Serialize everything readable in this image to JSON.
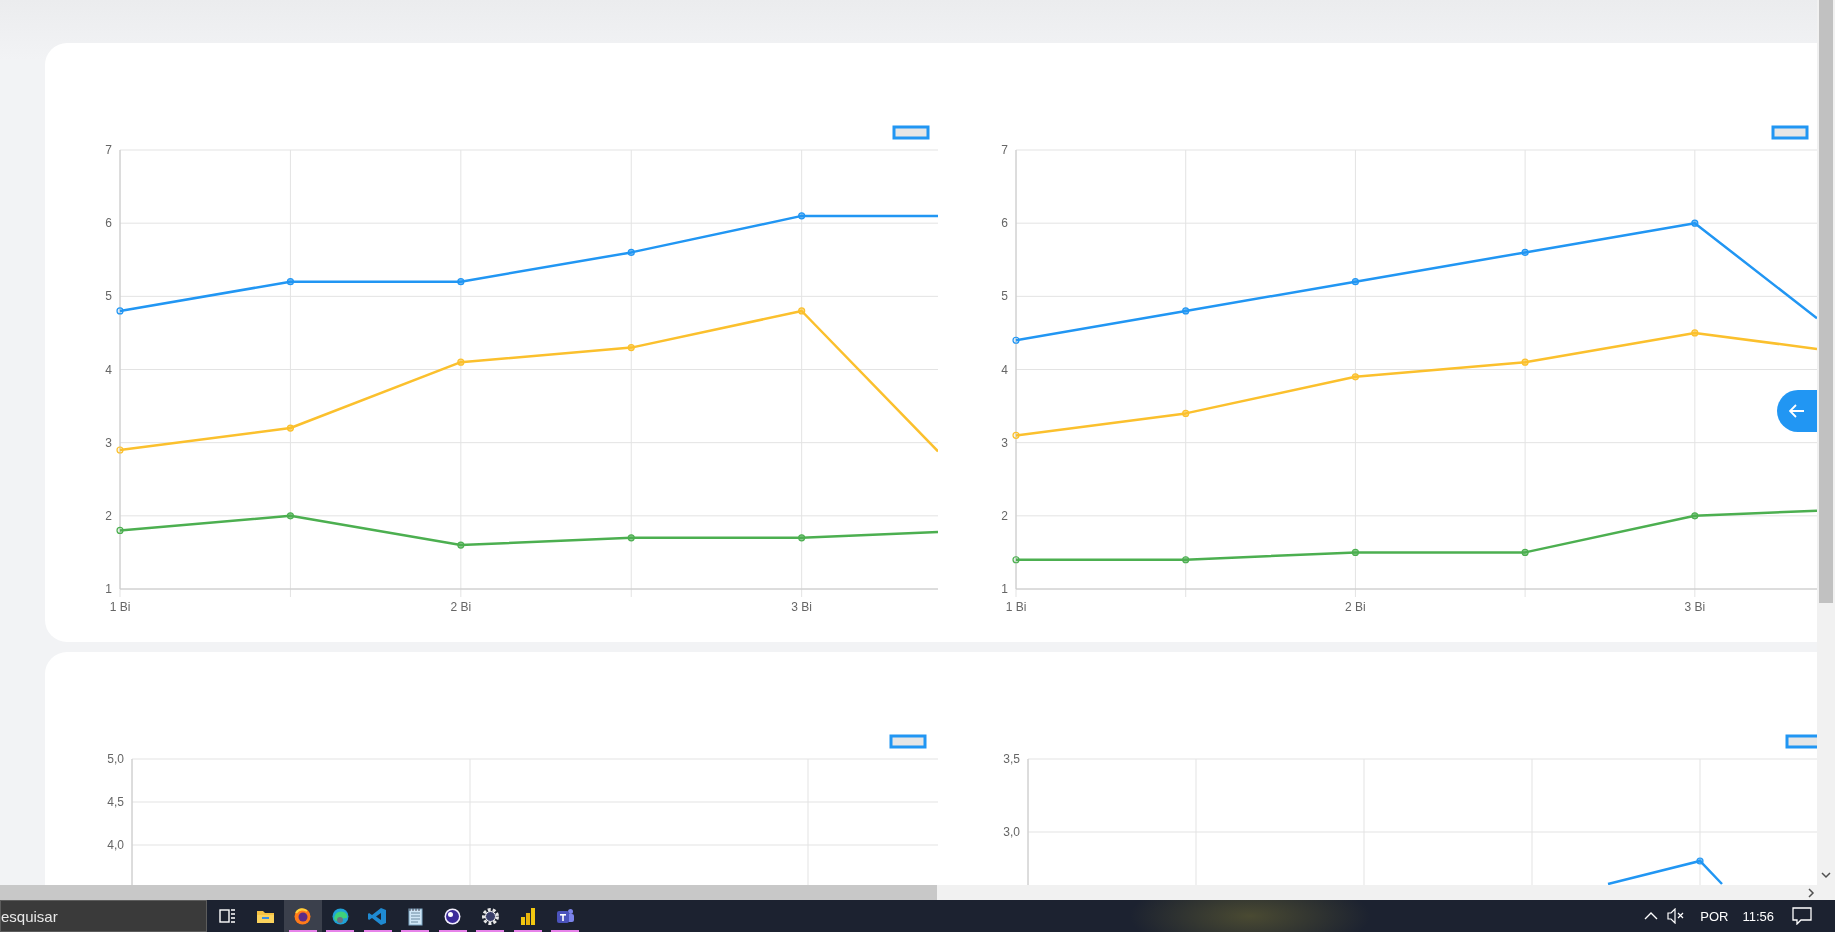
{
  "dashboard": {
    "cards": [
      {
        "charts": [
          {
            "chart_data": {
              "type": "line",
              "grid": true,
              "x": [
                1,
                1.5,
                2,
                2.5,
                3,
                3.4
              ],
              "xlim": [
                1,
                3.4
              ],
              "xticks": [
                {
                  "value": 1,
                  "label": "1 Bi"
                },
                {
                  "value": 2,
                  "label": "2 Bi"
                },
                {
                  "value": 3,
                  "label": "3 Bi"
                }
              ],
              "ylim": [
                1,
                7
              ],
              "yticks": [
                1,
                2,
                3,
                4,
                5,
                6,
                7
              ],
              "series": [
                {
                  "color": "#2196f3",
                  "marker": "circle",
                  "values": [
                    4.8,
                    5.2,
                    5.2,
                    5.6,
                    6.1,
                    6.1
                  ]
                },
                {
                  "color": "#fbc02d",
                  "marker": "circle",
                  "values": [
                    2.9,
                    3.2,
                    4.1,
                    4.3,
                    4.8,
                    2.88
                  ]
                },
                {
                  "color": "#4caf50",
                  "marker": "circle",
                  "values": [
                    1.8,
                    2.0,
                    1.6,
                    1.7,
                    1.7,
                    1.78
                  ]
                }
              ]
            }
          },
          {
            "chart_data": {
              "type": "line",
              "grid": true,
              "x": [
                1,
                1.5,
                2,
                2.5,
                3,
                3.36
              ],
              "xlim": [
                1,
                3.36
              ],
              "xticks": [
                {
                  "value": 1,
                  "label": "1 Bi"
                },
                {
                  "value": 2,
                  "label": "2 Bi"
                },
                {
                  "value": 3,
                  "label": "3 Bi"
                }
              ],
              "ylim": [
                1,
                7
              ],
              "yticks": [
                1,
                2,
                3,
                4,
                5,
                6,
                7
              ],
              "series": [
                {
                  "color": "#2196f3",
                  "marker": "circle",
                  "values": [
                    4.4,
                    4.8,
                    5.2,
                    5.6,
                    6.0,
                    4.7
                  ]
                },
                {
                  "color": "#fbc02d",
                  "marker": "circle",
                  "values": [
                    3.1,
                    3.4,
                    3.9,
                    4.1,
                    4.5,
                    4.28
                  ]
                },
                {
                  "color": "#4caf50",
                  "marker": "circle",
                  "values": [
                    1.4,
                    1.4,
                    1.5,
                    1.5,
                    2.0,
                    2.07
                  ]
                }
              ]
            }
          }
        ]
      },
      {
        "charts": [
          {
            "plot": {
              "kind": "empty",
              "y_labels": [
                "5,0",
                "4,5",
                "4,0"
              ]
            }
          },
          {
            "plot": {
              "kind": "line",
              "y_labels": [
                "3,5",
                "3,0"
              ]
            }
          }
        ]
      }
    ]
  },
  "taskbar": {
    "search": {
      "placeholder": "esquisar"
    },
    "apps": [
      {
        "kind": "taskview",
        "running": false,
        "selected": false
      },
      {
        "kind": "folder",
        "running": false,
        "selected": false
      },
      {
        "kind": "ring",
        "running": true,
        "selected": true
      },
      {
        "kind": "swirl",
        "running": true,
        "selected": false
      },
      {
        "kind": "code",
        "running": true,
        "selected": false
      },
      {
        "kind": "notepad",
        "running": true,
        "selected": false
      },
      {
        "kind": "orb",
        "running": true,
        "selected": false
      },
      {
        "kind": "gear",
        "running": true,
        "selected": false
      },
      {
        "kind": "bars",
        "running": true,
        "selected": false
      },
      {
        "kind": "tile",
        "running": true,
        "selected": false
      }
    ],
    "tray": {
      "language": "POR",
      "time": "11:56"
    }
  }
}
